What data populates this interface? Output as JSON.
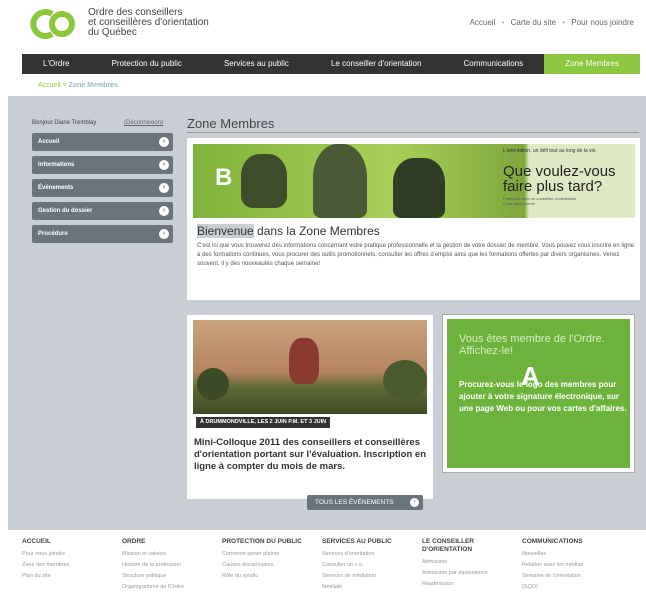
{
  "header": {
    "logo_lines": [
      "Ordre des conseillers",
      "et conseillères d'orientation",
      "du Québec"
    ],
    "util_links": [
      "Accueil",
      "Carte du site",
      "Pour nous joindre"
    ]
  },
  "nav": {
    "items": [
      "L'Ordre",
      "Protection du public",
      "Services au public",
      "Le conseiller d'orientation",
      "Communications",
      "Zone Membres"
    ]
  },
  "breadcrumb": {
    "home": "Accueil",
    "sep": ">",
    "current": "Zone Membres"
  },
  "sidebar": {
    "greeting": "Bonjour Diane Tremblay",
    "logout": "(Déconnexion)",
    "items": [
      "Accueil",
      "Informations",
      "Événements",
      "Gestion du dossier",
      "Procédure"
    ]
  },
  "main": {
    "title": "Zone Membres",
    "banner": {
      "marker": "B",
      "tagline": "L'orientation, un défi tout au long de la vie.",
      "question": "Que voulez-vous faire plus tard?",
      "small": "Parlez-en avec un conseiller d'orientation. C'est votre avenir!"
    },
    "welcome_prefix": "Bienvenue",
    "welcome_rest": " dans la Zone Membres",
    "intro": "C'est ici que vous trouverez des informations concernant votre pratique professionnelle et la gestion de votre dossier de membre. Vous pouvez vous inscrire en ligne à des formations continues, vous procurer des outils promotionnels, consulter les offres d'emploi ainsi que les formations offertes par divers organismes.  Venez souvent, il y des nouveautés chaque semaine!"
  },
  "event": {
    "when": "À DRUMMONDVILLE, LES 2 JUIN P.M. ET 3 JUIN",
    "title": "Mini-Colloque 2011 des conseillers et conseillères d'orientation portant sur l'évaluation. Inscription en ligne à compter du mois de mars.",
    "button": "TOUS LES ÉVÉNEMENTS"
  },
  "promo": {
    "marker": "A",
    "heading": "Vous êtes membre de l'Ordre. Affichez-le!",
    "text": "Procurez-vous le logo des membres pour ajouter à votre signature électronique, sur une page Web ou pour vos cartes d'affaires."
  },
  "footer": {
    "columns": [
      {
        "heading": "ACCUEIL",
        "links": [
          "Pour nous joindre",
          "Zone des membres",
          "Plan du site"
        ]
      },
      {
        "heading": "ORDRE",
        "links": [
          "Mission et valeurs",
          "Histoire de la profession",
          "Structure politique",
          "Organigramme de l'Ordre"
        ]
      },
      {
        "heading": "PROTECTION DU PUBLIC",
        "links": [
          "Comment porter plainte",
          "Causes disciplinaires",
          "Rôle du syndic"
        ]
      },
      {
        "heading": "SERVICES AU PUBLIC",
        "links": [
          "Services d'orientation",
          "Consulter un c.o.",
          "Services de médiation",
          "familiale"
        ]
      },
      {
        "heading": "LE CONSEILLER D'ORIENTATION",
        "links": [
          "Admission",
          "Admission par équivalence",
          "Réadmission"
        ]
      },
      {
        "heading": "COMMUNICATIONS",
        "links": [
          "Nouvelles",
          "Relation avec les médias",
          "Semaine de l'orientation",
          "(SQO)"
        ]
      }
    ]
  },
  "colors": {
    "brand_green": "#8dc63f",
    "nav_dark": "#333333",
    "panel_gray": "#c8ced3"
  }
}
